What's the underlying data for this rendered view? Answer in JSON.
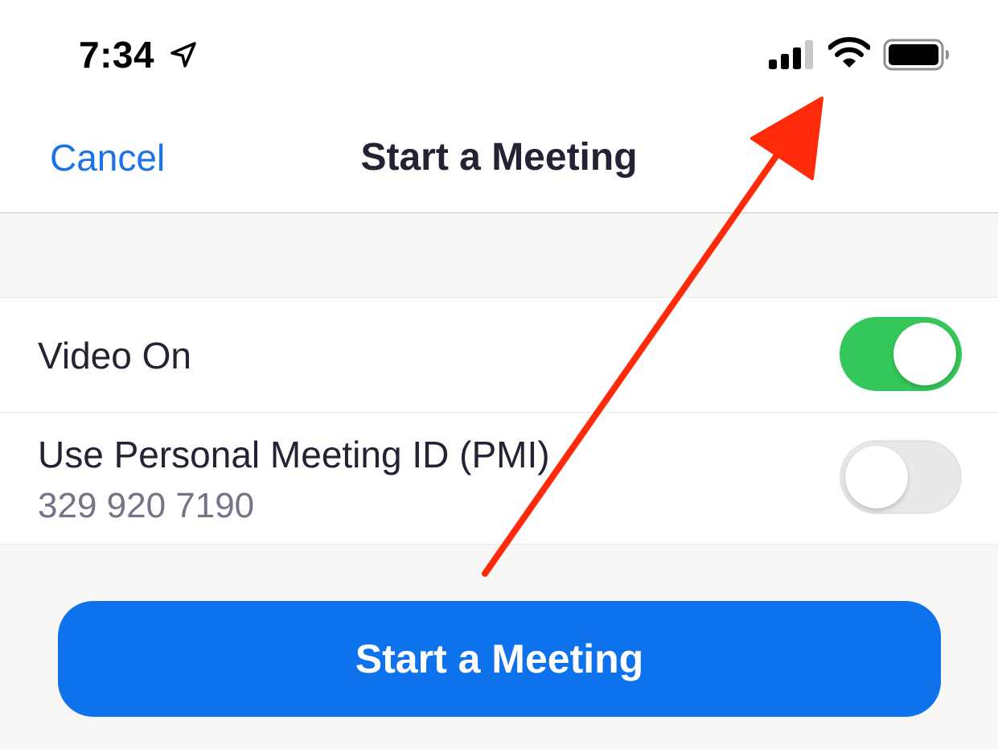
{
  "status_bar": {
    "time": "7:34",
    "location_icon": "location-arrow-icon",
    "signal_icon": "cellular-signal-icon",
    "wifi_icon": "wifi-icon",
    "battery_icon": "battery-icon"
  },
  "nav": {
    "cancel_label": "Cancel",
    "title": "Start a Meeting"
  },
  "settings": {
    "video_on": {
      "label": "Video On",
      "enabled": true
    },
    "pmi": {
      "label": "Use Personal Meeting ID (PMI)",
      "value": "329 920 7190",
      "enabled": false
    }
  },
  "actions": {
    "start_label": "Start a Meeting"
  },
  "colors": {
    "accent": "#0e72ed",
    "link": "#1a73e8",
    "toggle_on": "#34c759",
    "toggle_off": "#e9e9eb",
    "annotation_arrow": "#ff2a0a"
  }
}
